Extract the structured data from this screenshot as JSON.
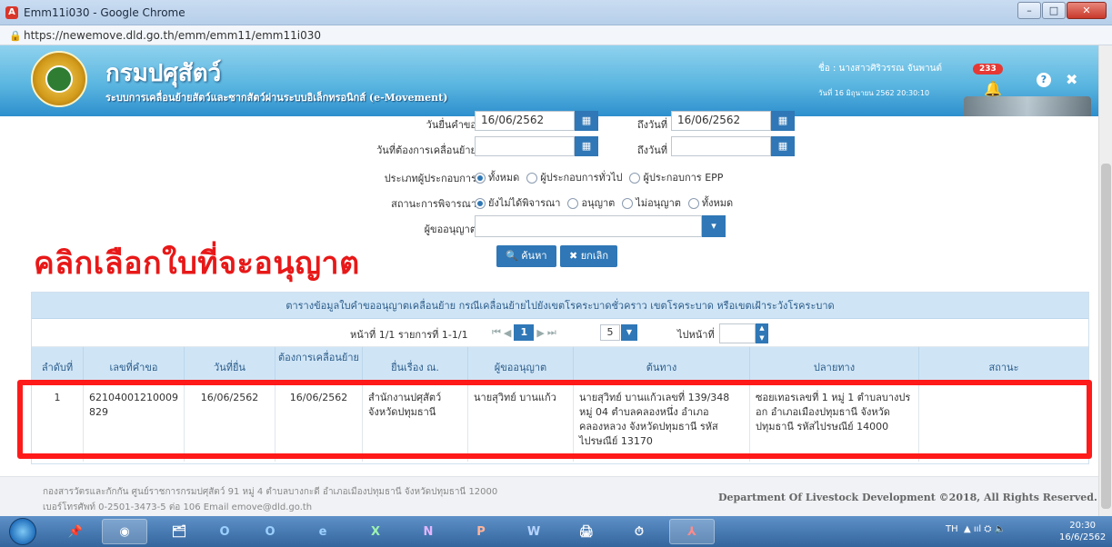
{
  "window": {
    "app_icon": "A",
    "title": "Emm11i030 - Google Chrome",
    "min_label": "–",
    "max_label": "□",
    "close_label": "✕"
  },
  "address": {
    "lock_icon": "🔒",
    "url": "https://newemove.dld.go.th/emm/emm11/emm11i030"
  },
  "header": {
    "dept_name": "กรมปศุสัตว์",
    "subtitle": "ระบบการเคลื่อนย้ายสัตว์และซากสัตว์ผ่านระบบอิเล็กทรอนิกส์ (e-Movement)",
    "user": "ชื่อ : นางสาวศิริวรรณ จันพานต์",
    "date": "วันที่ 16 มิถุนายน 2562 20:30:10",
    "notif_count": "233",
    "help_label": "?",
    "close_label": "✖",
    "bell_icon": "🔔"
  },
  "form": {
    "request_date_label": "วันยื่นคำขอ",
    "request_date_value": "16/06/2562",
    "to_date_label": "ถึงวันที่",
    "to_date_value": "16/06/2562",
    "move_date_label": "วันที่ต้องการเคลื่อนย้าย",
    "move_date_value": "",
    "move_to_label": "ถึงวันที่",
    "move_to_value": "",
    "calendar_icon": "▦",
    "operator_type_label": "ประเภทผู้ประกอบการ",
    "operator_options": [
      "ทั้งหมด",
      "ผู้ประกอบการทั่วไป",
      "ผู้ประกอบการ EPP"
    ],
    "status_label": "สถานะการพิจารณา",
    "status_options": [
      "ยังไม่ได้พิจารณา",
      "อนุญาต",
      "ไม่อนุญาต",
      "ทั้งหมด"
    ],
    "approver_label": "ผู้ขออนุญาต",
    "approver_value": "",
    "dropdown_icon": "▾",
    "search_label": "🔍 ค้นหา",
    "cancel_label": "✖ ยกเลิก"
  },
  "overlay_note": "คลิกเลือกใบที่จะอนุญาต",
  "table": {
    "caption": "ตารางข้อมูลใบคำขออนุญาตเคลื่อนย้าย กรณีเคลื่อนย้ายไปยังเขตโรคระบาดชั่วคราว เขตโรคระบาด หรือเขตเฝ้าระวังโรคระบาด",
    "pager_info": "หน้าที่ 1/1 รายการที่ 1-1/1",
    "pager_first": "⏮",
    "pager_prev": "◀",
    "pager_page": "1",
    "pager_next": "▶",
    "pager_last": "⏭",
    "page_size": "5",
    "goto_label": "ไปหน้าที่",
    "columns": [
      "ลำดับที่",
      "เลขที่คำขอ",
      "วันที่ยื่น",
      "ต้องการเคลื่อนย้าย",
      "ยื่นเรื่อง ณ.",
      "ผู้ขออนุญาต",
      "ต้นทาง",
      "ปลายทาง",
      "สถานะ"
    ],
    "rows": [
      {
        "no": "1",
        "request_no": "62104001210009829",
        "submit_date": "16/06/2562",
        "move_date": "16/06/2562",
        "submitted_at": "สำนักงานปศุสัตว์จังหวัดปทุมธานี",
        "applicant": "นายสุวิทย์ บานแก้ว",
        "origin": "นายสุวิทย์ บานแก้วเลขที่ 139/348 หมู่ 04 ตำบลคลองหนึ่ง อำเภอคลองหลวง จังหวัดปทุมธานี รหัสไปรษณีย์ 13170",
        "destination": "ซอยเทอรเลขที่ 1 หมู่ 1 ตำบลบางปรอก อำเภอเมืองปทุมธานี จังหวัดปทุมธานี รหัสไปรษณีย์ 14000",
        "status": ""
      }
    ]
  },
  "footer": {
    "line1": "กองสารวัตรและกักกัน ศูนย์ราชการกรมปศุสัตว์ 91 หมู่ 4 ตำบลบางกะดี อำเภอเมืองปทุมธานี จังหวัดปทุมธานี 12000",
    "line2": "เบอร์โทรศัพท์ 0-2501-3473-5 ต่อ 106 Email emove@dld.go.th",
    "rights": "Department Of Livestock Development ©2018, All Rights Reserved."
  },
  "taskbar": {
    "apps": [
      "📌",
      "◉",
      "🗂",
      "O",
      "O",
      "e",
      "X",
      "N",
      "P",
      "W",
      "🖨",
      "⏱",
      "⅄"
    ],
    "lang": "TH",
    "tray_icons": "▲ ııl ⛭ 🔈",
    "time": "20:30",
    "date": "16/6/2562"
  }
}
